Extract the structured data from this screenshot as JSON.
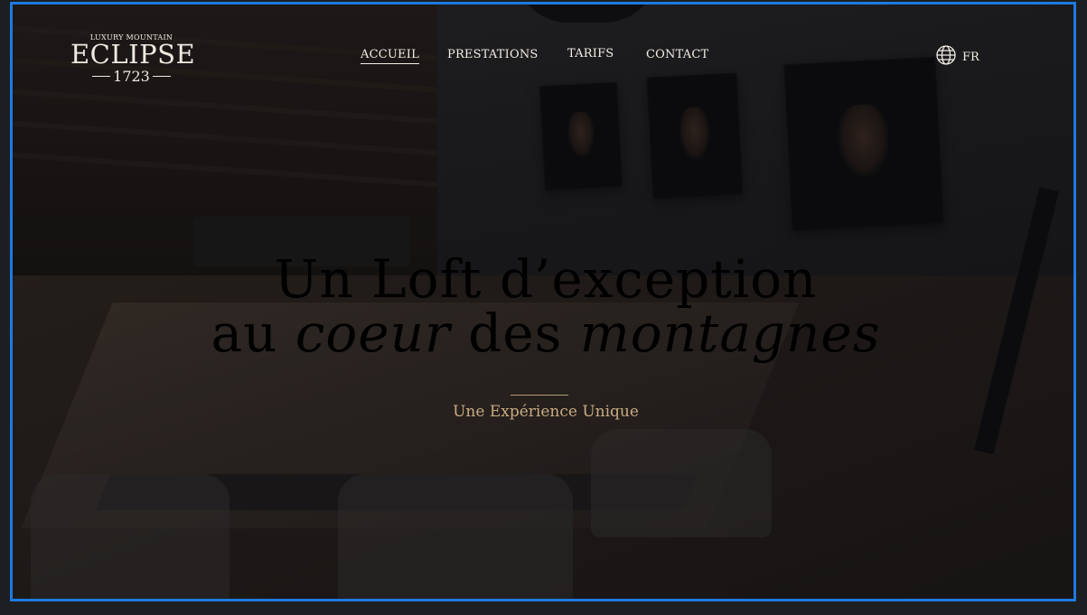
{
  "logo": {
    "tagline": "LUXURY MOUNTAIN",
    "name": "ECLIPSE",
    "year": "1723"
  },
  "nav": {
    "items": [
      {
        "label": "ACCUEIL",
        "active": true
      },
      {
        "label": "PRESTATIONS",
        "active": false
      },
      {
        "label": "TARIFS",
        "active": false
      },
      {
        "label": "CONTACT",
        "active": false
      }
    ]
  },
  "language": {
    "icon": "globe-icon",
    "label": "FR"
  },
  "hero": {
    "line1": "Un Loft d’exception",
    "line2_part1": "au ",
    "line2_em1": "coeur",
    "line2_part2": " des ",
    "line2_em2": "montagnes",
    "subtitle": "Une Expérience Unique"
  },
  "colors": {
    "frame_border": "#1e7ae0",
    "text_light": "#f2ede5",
    "accent_gold": "#c9ab82"
  }
}
